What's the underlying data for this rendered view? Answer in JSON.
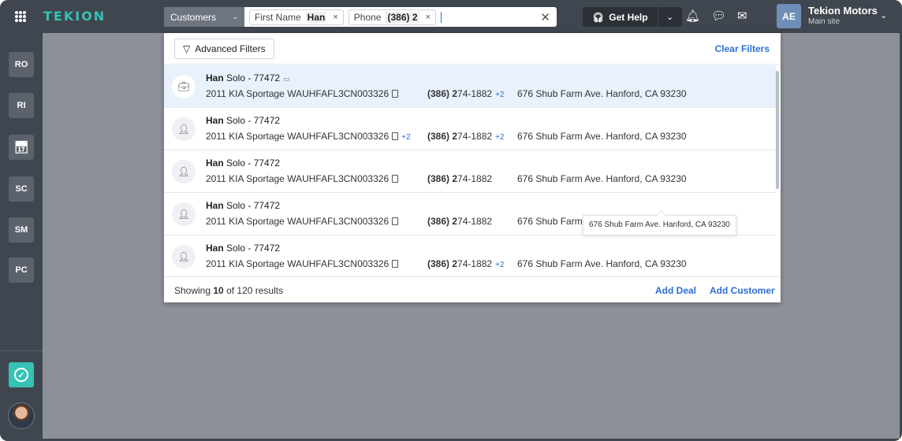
{
  "app": {
    "logo": "TEKION",
    "apps_icon": "apps-grid-icon"
  },
  "search": {
    "entity": "Customers",
    "chips": [
      {
        "key": "First Name",
        "value": "Han",
        "remove": "×"
      },
      {
        "key": "Phone",
        "value": "(386) 2",
        "remove": "×"
      }
    ],
    "clear": "✕"
  },
  "header": {
    "get_help": "Get Help",
    "help_icon": "headset-icon",
    "help_dropdown": "⌄",
    "icons": [
      "bell-icon",
      "chat-icon",
      "mail-icon"
    ],
    "user_initials": "AE",
    "site_name": "Tekion Motors",
    "site_sub": "Main site"
  },
  "rail": {
    "items": [
      {
        "label": "RO"
      },
      {
        "label": "RI"
      },
      {
        "label": "",
        "icon": "calendar-clock-icon"
      },
      {
        "label": "SC"
      },
      {
        "label": "SM"
      },
      {
        "label": "PC"
      }
    ]
  },
  "panel": {
    "advanced_filters": "Advanced Filters",
    "clear_filters": "Clear Filters",
    "rows": [
      {
        "first": "Han",
        "rest": " Solo - 77472",
        "vehicle": "2011 KIA Sportage WAUHFAFL3CN003326",
        "vehicle_plus": "",
        "phone_bold": "(386) 2",
        "phone_rest": "74-1882",
        "phone_plus": "+2",
        "address": "676 Shub Farm Ave. Hanford, CA 93230",
        "icon": "briefcase-icon",
        "selected": true
      },
      {
        "first": "Han",
        "rest": " Solo - 77472",
        "vehicle": "2011 KIA Sportage WAUHFAFL3CN003326",
        "vehicle_plus": "+2",
        "phone_bold": "(386) 2",
        "phone_rest": "74-1882",
        "phone_plus": "+2",
        "address": "676 Shub Farm Ave. Hanford, CA 93230",
        "icon": "person-icon"
      },
      {
        "first": "Han",
        "rest": " Solo - 77472",
        "vehicle": "2011 KIA Sportage WAUHFAFL3CN003326",
        "vehicle_plus": "",
        "phone_bold": "(386) 2",
        "phone_rest": "74-1882",
        "phone_plus": "",
        "address": "676 Shub Farm Ave. Hanford, CA 93230",
        "icon": "person-icon"
      },
      {
        "first": "Han",
        "rest": " Solo - 77472",
        "vehicle": "2011 KIA Sportage WAUHFAFL3CN003326",
        "vehicle_plus": "",
        "phone_bold": "(386) 2",
        "phone_rest": "74-1882",
        "phone_plus": "",
        "address": "676 Shub Farm ",
        "icon": "person-icon"
      },
      {
        "first": "Han",
        "rest": " Solo - 77472",
        "vehicle": "2011 KIA Sportage WAUHFAFL3CN003326",
        "vehicle_plus": "",
        "phone_bold": "(386) 2",
        "phone_rest": "74-1882",
        "phone_plus": "+2",
        "address": "676 Shub Farm Ave. Hanford, CA 93230",
        "icon": "person-icon"
      }
    ],
    "tooltip": "676 Shub Farm Ave. Hanford, CA 93230",
    "footer": {
      "showing_prefix": "Showing ",
      "showing_count": "10",
      "showing_suffix": " of 120 results",
      "add_deal": "Add Deal",
      "add_customer": "Add Customer"
    }
  }
}
